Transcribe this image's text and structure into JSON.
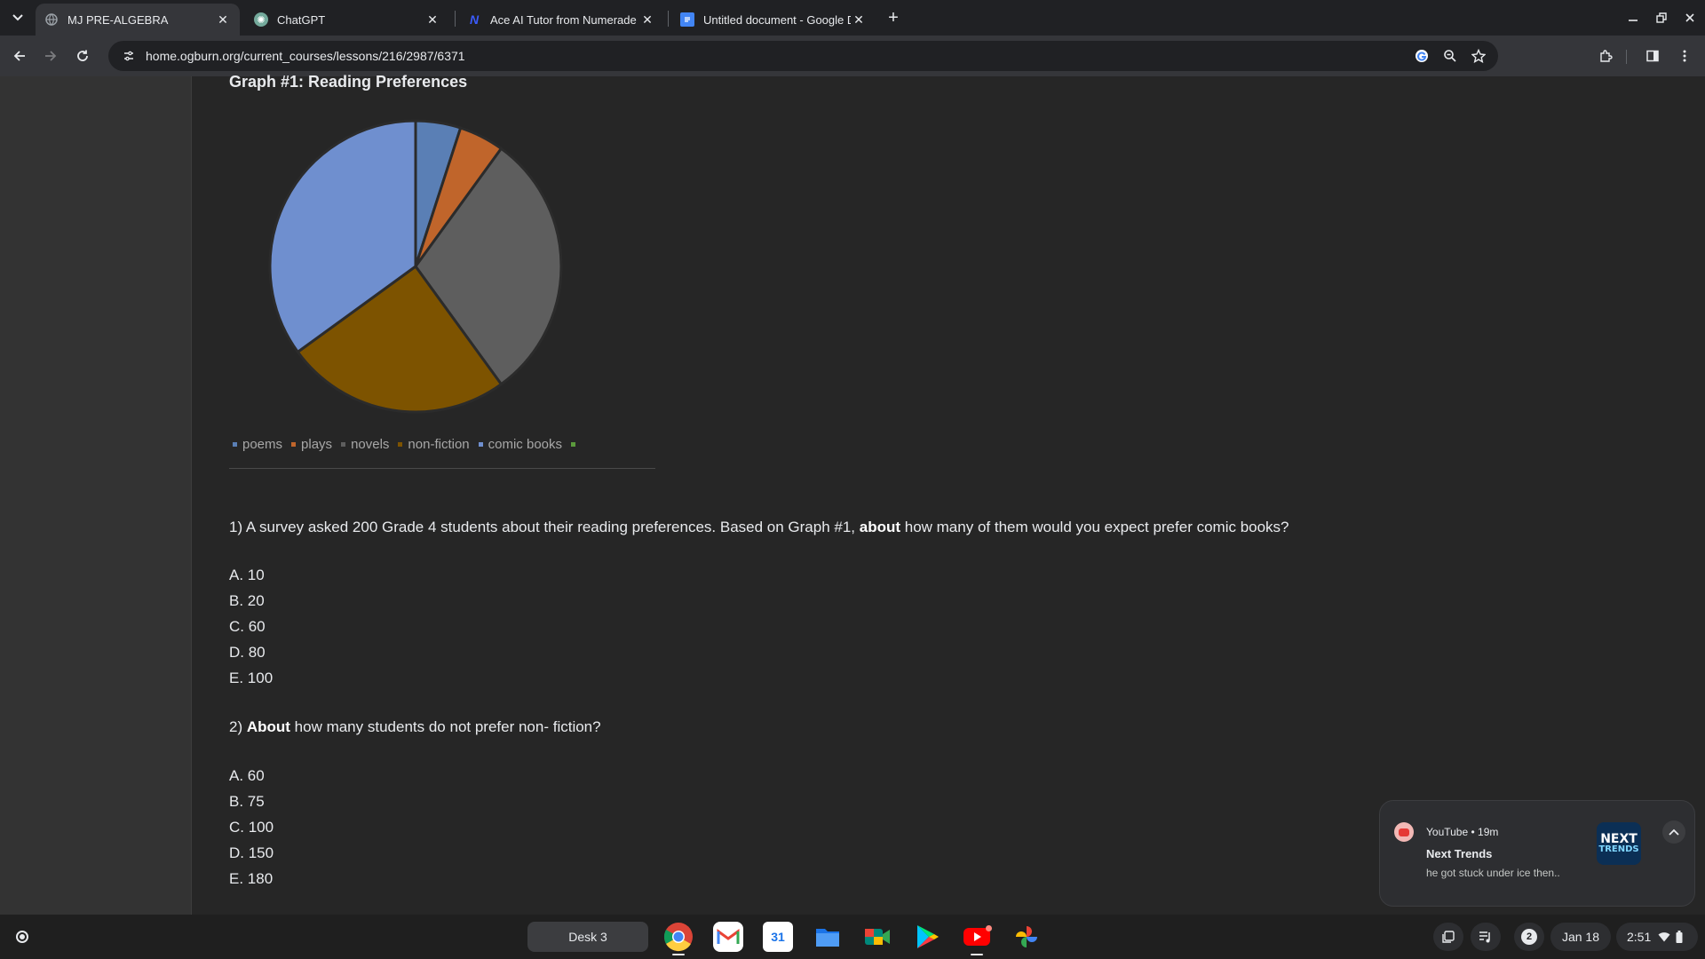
{
  "browser": {
    "tabs": [
      {
        "label": "MJ PRE-ALGEBRA",
        "active": true
      },
      {
        "label": "ChatGPT",
        "active": false
      },
      {
        "label": "Ace AI Tutor from Numerade",
        "active": false
      },
      {
        "label": "Untitled document - Google Do",
        "active": false
      }
    ],
    "favicon_glyphs": {
      "chatgpt": "✺",
      "numerade": "N"
    },
    "url": "home.ogburn.org/current_courses/lessons/216/2987/6371"
  },
  "page": {
    "graph_title": "Graph #1: Reading Preferences",
    "question1": {
      "number": "1)",
      "text_before": " A survey asked 200 Grade 4 students about their reading preferences. Based on Graph #1, ",
      "bold": "about",
      "text_after": " how many of them would you expect prefer comic books?"
    },
    "question1_options": [
      "A. 10",
      "B. 20",
      "C. 60",
      "D. 80",
      "E. 100"
    ],
    "question2": {
      "number": "2) ",
      "bold": "About",
      "text_after": " how many students do not prefer non- fiction?"
    },
    "question2_options": [
      "A. 60",
      "B. 75",
      "C. 100",
      "D. 150",
      "E. 180"
    ]
  },
  "chart_data": {
    "type": "pie",
    "title": "Graph #1: Reading Preferences",
    "categories": [
      "poems",
      "plays",
      "novels",
      "non-fiction",
      "comic books",
      ""
    ],
    "values": [
      5,
      5,
      30,
      25,
      35,
      0
    ],
    "colors": [
      "#5a7fb5",
      "#c0652b",
      "#5e5e5e",
      "#7d5300",
      "#6f8fcf",
      "#5b9a3c"
    ],
    "legend": "bottom"
  },
  "notification": {
    "app": "YouTube",
    "age": "19m",
    "title": "Next Trends",
    "message": "he got stuck under ice then..",
    "thumb_line1": "NEXT",
    "thumb_line2": "TRENDS"
  },
  "shelf": {
    "desk_label": "Desk 3",
    "calendar_day": "31",
    "notification_count": "2",
    "date": "Jan 18",
    "time": "2:51"
  }
}
